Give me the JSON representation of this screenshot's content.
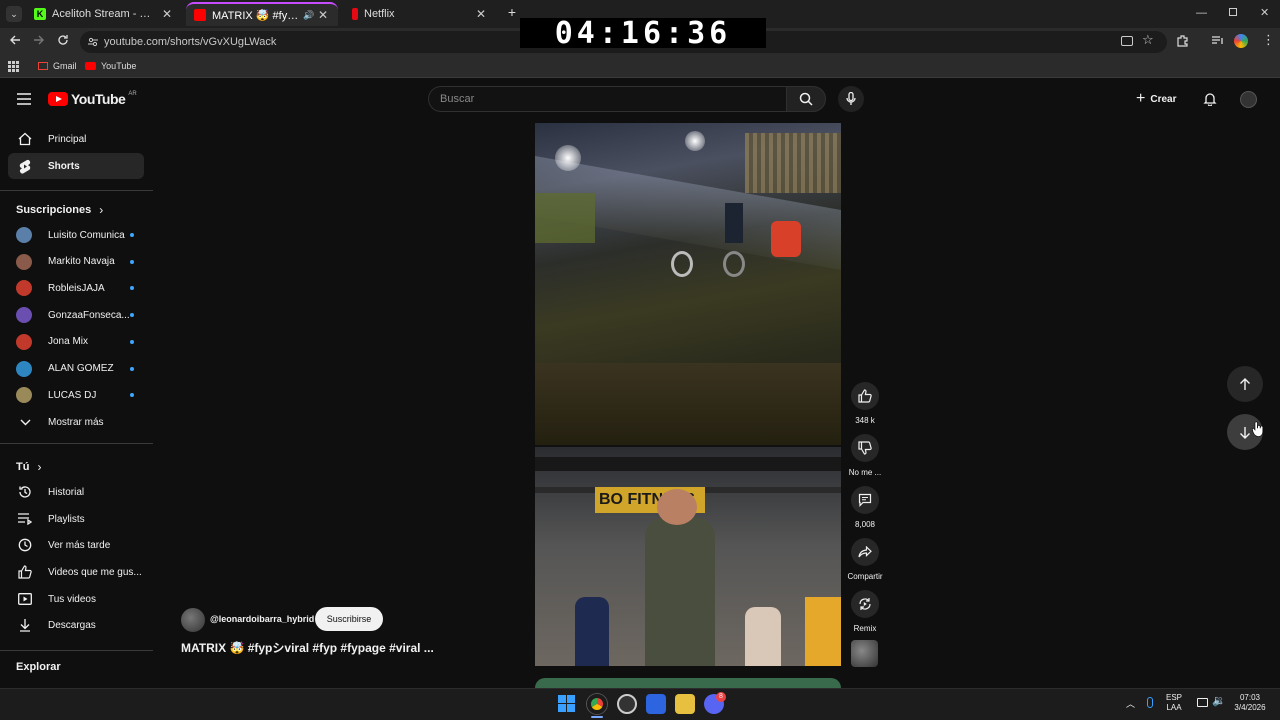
{
  "browser": {
    "tabs": [
      {
        "title": "Acelitoh Stream - Watch Live on",
        "favicon_color": "#53fc18",
        "active": false
      },
      {
        "title": "MATRIX 🤯 #fypシviral #fyp",
        "favicon_color": "#ff0000",
        "active": true
      },
      {
        "title": "Netflix",
        "favicon_color": "#e50914",
        "active": false
      }
    ],
    "new_tab": "+",
    "url": "youtube.com/shorts/vGvXUgLWack",
    "bookmarks": [
      {
        "label": "Gmail",
        "icon": "gmail-icon"
      },
      {
        "label": "YouTube",
        "icon": "youtube-icon"
      }
    ]
  },
  "overlay": {
    "clock": "04:16:36"
  },
  "header": {
    "logo_text": "YouTube",
    "region": "AR",
    "search_placeholder": "Buscar",
    "create_label": "Crear"
  },
  "sidebar": {
    "main": [
      {
        "label": "Principal",
        "icon": "home-icon"
      },
      {
        "label": "Shorts",
        "icon": "shorts-icon",
        "selected": true
      }
    ],
    "subscriptions_title": "Suscripciones",
    "subscriptions": [
      {
        "name": "Luisito Comunica",
        "color": "#5a7fa8"
      },
      {
        "name": "Markito Navaja",
        "color": "#8a5a4a"
      },
      {
        "name": "RobleisJAJA",
        "color": "#c0392b"
      },
      {
        "name": "GonzaaFonseca...",
        "color": "#6b4fb0"
      },
      {
        "name": "Jona Mix",
        "color": "#c0392b"
      },
      {
        "name": "ALAN GOMEZ",
        "color": "#2e86c1"
      },
      {
        "name": "LUCAS DJ",
        "color": "#9a8a5a"
      }
    ],
    "show_more": "Mostrar más",
    "you_title": "Tú",
    "you_items": [
      {
        "label": "Historial",
        "icon": "history-icon"
      },
      {
        "label": "Playlists",
        "icon": "playlist-icon"
      },
      {
        "label": "Ver más tarde",
        "icon": "clock-icon"
      },
      {
        "label": "Videos que me gus...",
        "icon": "like-icon"
      },
      {
        "label": "Tus videos",
        "icon": "video-icon"
      },
      {
        "label": "Descargas",
        "icon": "download-icon"
      }
    ],
    "explore_title": "Explorar"
  },
  "short": {
    "channel": "@leonardoibarra_hybrid",
    "subscribe_label": "Suscribirse",
    "title": "MATRIX 🤯 #fypシviral #fyp #fypage #viral ..."
  },
  "actions": {
    "likes": "348 k",
    "dislike": "No me ...",
    "comments": "8,008",
    "share": "Compartir",
    "remix": "Remix"
  },
  "taskbar": {
    "language": "ESP",
    "language_sub": "LAA",
    "time": "07:03",
    "date": "3/4/2026",
    "discord_badge": "8"
  }
}
